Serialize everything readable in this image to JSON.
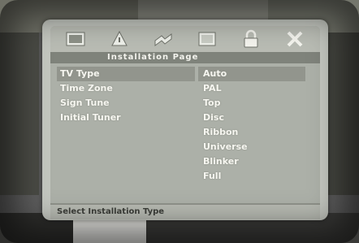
{
  "osd": {
    "title": "Installation Page",
    "tabs": [
      {
        "icon": "general-setup-icon"
      },
      {
        "icon": "audio-setup-icon"
      },
      {
        "icon": "video-setup-icon"
      },
      {
        "icon": "preference-icon"
      },
      {
        "icon": "lock-icon"
      },
      {
        "icon": "exit-icon"
      }
    ],
    "menu_items": [
      {
        "label": "TV Type"
      },
      {
        "label": "Time Zone"
      },
      {
        "label": "Sign Tune"
      },
      {
        "label": "Initial Tuner"
      }
    ],
    "options": [
      {
        "label": "Auto"
      },
      {
        "label": "PAL"
      },
      {
        "label": "Top"
      },
      {
        "label": "Disc"
      },
      {
        "label": "Ribbon"
      },
      {
        "label": "Universe"
      },
      {
        "label": "Blinker"
      },
      {
        "label": "Full"
      }
    ],
    "status": "Select Installation Type",
    "colors": {
      "panel": "#c3c6bf",
      "highlight": "#92958d",
      "title_bar": "#7f837b",
      "text": "#f6f6f0"
    }
  }
}
